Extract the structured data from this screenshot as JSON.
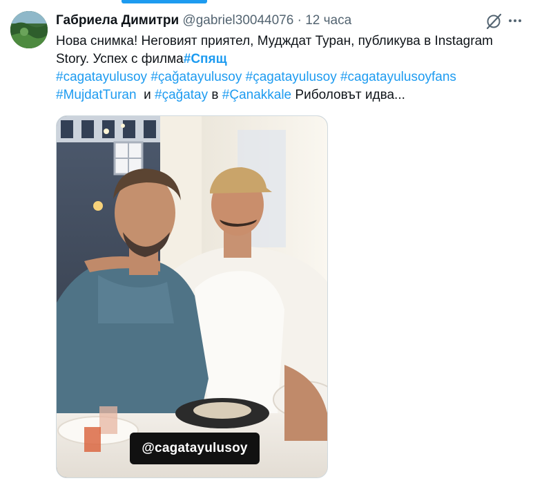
{
  "tweet": {
    "author_name": "Габриела Димитри",
    "handle": "@gabriel30044076",
    "separator": "·",
    "time": "12 часа",
    "text": {
      "l1": "Нова снимка! Неговият приятел, Мудждат Туран, публикува в Instagram",
      "l2_plain": "Story. Успех с филма",
      "l2_tag": "#Спящ",
      "l3_tag1": "#cagatayulusoy",
      "l3_tag2": "#çağatayulusoy",
      "l3_tag3": "#çagatayulusoy",
      "l3_tag4": "#cagatayulusoyfans",
      "l4_tag1": "#MujdatTuran",
      "l4_and": "и",
      "l4_tag2": "#çağatay",
      "l4_in": "в",
      "l4_tag3": "#Çanakkale",
      "l4_tail": "Риболовът идва..."
    },
    "image": {
      "sticker_text": "@cagatayulusoy"
    }
  },
  "icons": {
    "grok": "grok-icon",
    "more": "more-options-icon",
    "avatar": "avatar"
  },
  "colors": {
    "link": "#1d9bf0",
    "text": "#0f1419",
    "secondary": "#536471"
  }
}
